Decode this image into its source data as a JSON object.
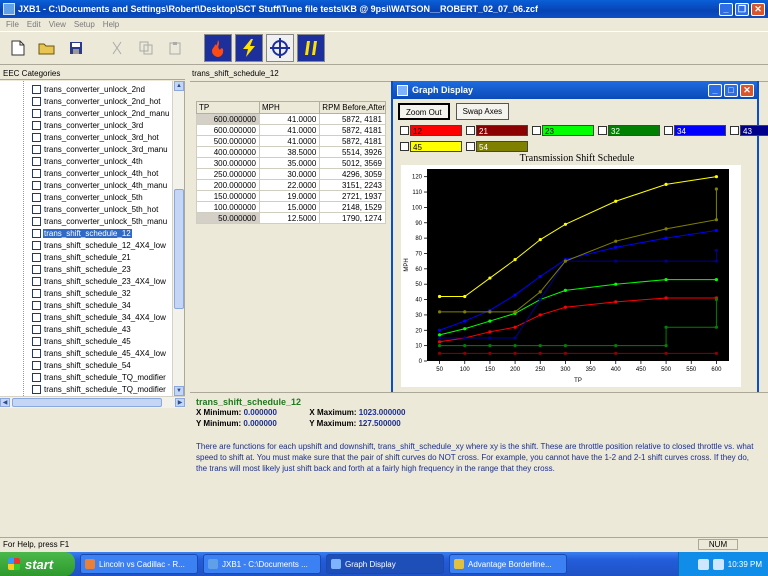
{
  "window": {
    "title": "JXB1 - C:\\Documents and Settings\\Robert\\Desktop\\SCT Stuff\\Tune file tests\\KB @ 9psi\\WATSON__ROBERT_02_07_06.zcf"
  },
  "menu": [
    "File",
    "Edit",
    "View",
    "Setup",
    "Help"
  ],
  "left_panel": {
    "header": "EEC Categories",
    "items": [
      "trans_converter_unlock_2nd",
      "trans_converter_unlock_2nd_hot",
      "trans_converter_unlock_2nd_manu",
      "trans_converter_unlock_3rd",
      "trans_converter_unlock_3rd_hot",
      "trans_converter_unlock_3rd_manu",
      "trans_converter_unlock_4th",
      "trans_converter_unlock_4th_hot",
      "trans_converter_unlock_4th_manu",
      "trans_converter_unlock_5th",
      "trans_converter_unlock_5th_hot",
      "trans_converter_unlock_5th_manu",
      "trans_shift_schedule_12",
      "trans_shift_schedule_12_4X4_low",
      "trans_shift_schedule_21",
      "trans_shift_schedule_23",
      "trans_shift_schedule_23_4X4_low",
      "trans_shift_schedule_32",
      "trans_shift_schedule_34",
      "trans_shift_schedule_34_4X4_low",
      "trans_shift_schedule_43",
      "trans_shift_schedule_45",
      "trans_shift_schedule_45_4X4_low",
      "trans_shift_schedule_54",
      "trans_shift_schedule_TQ_modifier",
      "trans_shift_schedule_TQ_modifier"
    ],
    "selected_index": 12
  },
  "table": {
    "title": "trans_shift_schedule_12",
    "headers": [
      "TP",
      "MPH",
      "RPM Before,After"
    ],
    "rows": [
      [
        "600.000000",
        "41.0000",
        "5872, 4181"
      ],
      [
        "600.000000",
        "41.0000",
        "5872, 4181"
      ],
      [
        "500.000000",
        "41.0000",
        "5872, 4181"
      ],
      [
        "400.000000",
        "38.5000",
        "5514, 3926"
      ],
      [
        "300.000000",
        "35.0000",
        "5012, 3569"
      ],
      [
        "250.000000",
        "30.0000",
        "4296, 3059"
      ],
      [
        "200.000000",
        "22.0000",
        "3151, 2243"
      ],
      [
        "150.000000",
        "19.0000",
        "2721, 1937"
      ],
      [
        "100.000000",
        "15.0000",
        "2148, 1529"
      ],
      [
        "50.000000",
        "12.5000",
        "1790, 1274"
      ]
    ]
  },
  "graph_window": {
    "title": "Graph Display",
    "zoom_out_label": "Zoom Out",
    "swap_axes_label": "Swap Axes",
    "legend_row1": [
      {
        "label": "12",
        "color": "#ff0000"
      },
      {
        "label": "21",
        "color": "#8b0000"
      },
      {
        "label": "23",
        "color": "#00ff00"
      },
      {
        "label": "32",
        "color": "#008000"
      },
      {
        "label": "34",
        "color": "#0000ff"
      },
      {
        "label": "43",
        "color": "#00008b"
      }
    ],
    "legend_row2": [
      {
        "label": "45",
        "color": "#ffff00"
      },
      {
        "label": "54",
        "color": "#808000"
      }
    ]
  },
  "chart_data": {
    "type": "line",
    "title": "Transmission Shift Schedule",
    "xlabel": "TP",
    "ylabel": "MPH",
    "xlim": [
      25,
      625
    ],
    "ylim": [
      0,
      125
    ],
    "xticks": [
      50,
      100,
      150,
      200,
      250,
      300,
      350,
      400,
      450,
      500,
      550,
      600
    ],
    "yticks": [
      0,
      10,
      20,
      30,
      40,
      50,
      60,
      70,
      80,
      90,
      100,
      110,
      120
    ],
    "grid": false,
    "series": [
      {
        "name": "12",
        "color": "#ff0000",
        "x": [
          50,
          100,
          150,
          200,
          250,
          300,
          400,
          500,
          600,
          600
        ],
        "y": [
          12.5,
          15,
          19,
          22,
          30,
          35,
          38.5,
          41,
          41,
          41
        ]
      },
      {
        "name": "21",
        "color": "#8b0000",
        "x": [
          50,
          100,
          150,
          200,
          250,
          300,
          400,
          500,
          600
        ],
        "y": [
          5,
          5,
          5,
          5,
          5,
          5,
          5,
          5,
          5
        ]
      },
      {
        "name": "23",
        "color": "#00ff00",
        "x": [
          50,
          100,
          150,
          200,
          250,
          300,
          400,
          500,
          600
        ],
        "y": [
          17,
          21,
          26,
          31,
          40,
          46,
          50,
          53,
          53
        ]
      },
      {
        "name": "32",
        "color": "#008000",
        "x": [
          50,
          100,
          150,
          200,
          250,
          300,
          400,
          500,
          500,
          600,
          600
        ],
        "y": [
          10,
          10,
          10,
          10,
          10,
          10,
          10,
          10,
          22,
          22,
          40
        ]
      },
      {
        "name": "34",
        "color": "#0000ff",
        "x": [
          50,
          100,
          150,
          200,
          250,
          300,
          400,
          500,
          600
        ],
        "y": [
          20,
          26,
          33,
          43,
          55,
          66,
          74,
          80,
          85
        ]
      },
      {
        "name": "43",
        "color": "#00008b",
        "x": [
          50,
          100,
          150,
          200,
          250,
          300,
          400,
          500,
          600,
          600
        ],
        "y": [
          15,
          15,
          15,
          15,
          40,
          65,
          65,
          65,
          65,
          72
        ]
      },
      {
        "name": "45",
        "color": "#ffff00",
        "x": [
          50,
          100,
          150,
          200,
          250,
          300,
          400,
          500,
          600
        ],
        "y": [
          42,
          42,
          54,
          66,
          79,
          89,
          104,
          115,
          120
        ]
      },
      {
        "name": "54",
        "color": "#808000",
        "x": [
          50,
          100,
          150,
          200,
          250,
          300,
          400,
          500,
          600,
          600
        ],
        "y": [
          32,
          32,
          32,
          32,
          45,
          65,
          78,
          86,
          92,
          112
        ]
      }
    ]
  },
  "description": {
    "title": "trans_shift_schedule_12",
    "x_min_label": "X Minimum:",
    "x_min": "0.000000",
    "x_max_label": "X Maximum:",
    "x_max": "1023.000000",
    "y_min_label": "Y Minimum:",
    "y_min": "0.000000",
    "y_max_label": "Y Maximum:",
    "y_max": "127.500000",
    "text": "There are functions for each upshift and downshift, trans_shift_schedule_xy where xy is the shift. These are throttle position relative to closed throttle vs. what speed to shift at. You must make sure that the pair of shift curves do NOT cross. For example, you cannot have the 1-2 and 2-1 shift curves cross. If they do, the trans will most likely just shift back and forth at a fairly high frequency in the range that they cross."
  },
  "status": {
    "text": "For Help, press F1",
    "num": "NUM"
  },
  "taskbar": {
    "start": "start",
    "tasks": [
      {
        "label": "Lincoln vs Cadillac - R...",
        "color": "#e8803a"
      },
      {
        "label": "JXB1 - C:\\Documents ...",
        "color": "#5fa0e8"
      },
      {
        "label": "Graph Display",
        "color": "#7fb2ff"
      },
      {
        "label": "Advantage Borderline...",
        "color": "#e0c040"
      }
    ],
    "active_task": 2,
    "clock": "10:39 PM"
  }
}
